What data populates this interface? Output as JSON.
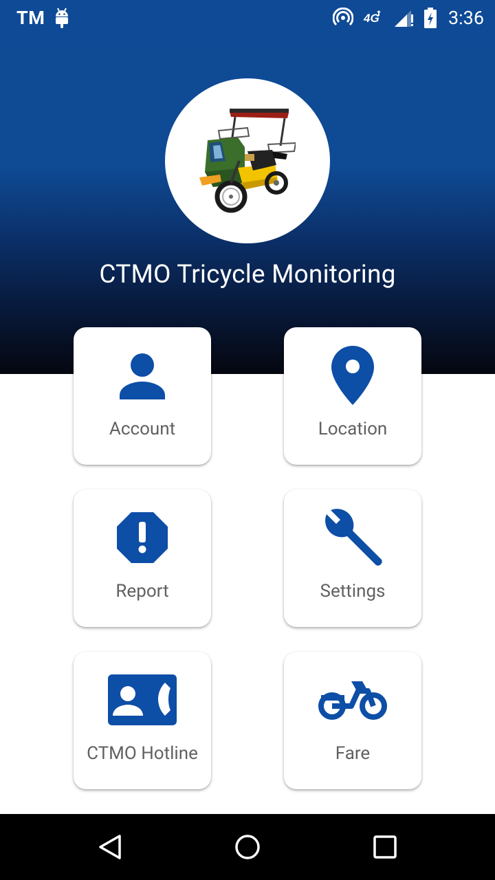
{
  "status_bar": {
    "carrier": "TM",
    "network": "4G",
    "time": "3:36"
  },
  "header": {
    "title": "CTMO Tricycle Monitoring",
    "logo_icon": "tricycle-image"
  },
  "tiles": [
    {
      "label": "Account",
      "icon": "person-icon"
    },
    {
      "label": "Location",
      "icon": "map-pin-icon"
    },
    {
      "label": "Report",
      "icon": "alert-octagon-icon"
    },
    {
      "label": "Settings",
      "icon": "wrench-icon"
    },
    {
      "label": "CTMO Hotline",
      "icon": "contact-phone-icon"
    },
    {
      "label": "Fare",
      "icon": "motorcycle-icon"
    }
  ],
  "colors": {
    "primary": "#0f4a96",
    "icon": "#0d4ea6",
    "label": "#616161"
  }
}
